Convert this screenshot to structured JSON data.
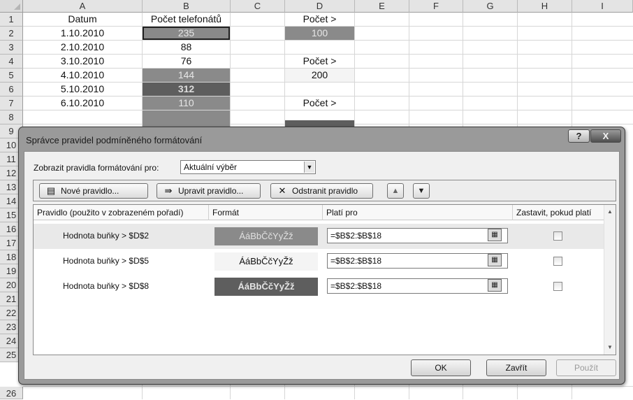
{
  "sheet": {
    "columns": [
      "A",
      "B",
      "C",
      "D",
      "E",
      "F",
      "G",
      "H",
      "I"
    ],
    "rows": [
      "1",
      "2",
      "3",
      "4",
      "5",
      "6",
      "7",
      "8",
      "9",
      "10",
      "11",
      "12",
      "13",
      "14",
      "15",
      "16",
      "17",
      "18",
      "19",
      "20",
      "21",
      "22",
      "23",
      "24",
      "25",
      "26"
    ],
    "cells": {
      "A1": "Datum",
      "B1": "Počet telefonátů",
      "D1": "Počet >",
      "A2": "1.10.2010",
      "B2": "235",
      "D2": "100",
      "A3": "2.10.2010",
      "B3": "88",
      "A4": "3.10.2010",
      "B4": "76",
      "D4": "Počet >",
      "A5": "4.10.2010",
      "B5": "144",
      "D5": "200",
      "A6": "5.10.2010",
      "B6": "312",
      "A7": "6.10.2010",
      "B7": "110",
      "D7": "Počet >"
    }
  },
  "dialog": {
    "title": "Správce pravidel podmíněného formátování",
    "help_label": "?",
    "close_label": "X",
    "show_rules_label": "Zobrazit pravidla formátování pro:",
    "show_rules_value": "Aktuální výběr",
    "toolbar": {
      "new_rule": "Nové pravidlo...",
      "edit_rule": "Upravit pravidlo...",
      "delete_rule": "Odstranit pravidlo"
    },
    "table_headers": {
      "rule": "Pravidlo (použito v zobrazeném pořadí)",
      "format": "Formát",
      "applies_to": "Platí pro",
      "stop_if_true": "Zastavit, pokud platí"
    },
    "rules": [
      {
        "condition": "Hodnota buňky > $D$2",
        "format_preview": "ÁáBbČčYyŽž",
        "applies_to": "=$B$2:$B$18",
        "stop": false
      },
      {
        "condition": "Hodnota buňky > $D$5",
        "format_preview": "ÁáBbČčYyŽž",
        "applies_to": "=$B$2:$B$18",
        "stop": false
      },
      {
        "condition": "Hodnota buňky > $D$8",
        "format_preview": "ÁáBbČčYyŽž",
        "applies_to": "=$B$2:$B$18",
        "stop": false
      }
    ],
    "buttons": {
      "ok": "OK",
      "close": "Zavřít",
      "apply": "Použít"
    }
  },
  "colors": {
    "fill_mid": "#8a8a8a",
    "fill_dark": "#5e5e5e",
    "fill_pale": "#f4f4f4",
    "dialog_frame": "#9a9a9a"
  }
}
